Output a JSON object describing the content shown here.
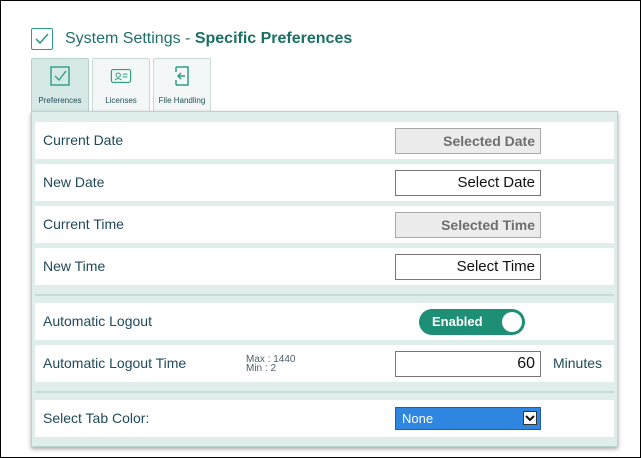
{
  "header": {
    "title_prefix": "System Settings - ",
    "title_emphasis": "Specific Preferences"
  },
  "tabs": [
    {
      "label": "Preferences",
      "icon": "checkbox-icon",
      "active": true
    },
    {
      "label": "Licenses",
      "icon": "license-card-icon",
      "active": false
    },
    {
      "label": "File Handling",
      "icon": "file-import-icon",
      "active": false
    }
  ],
  "settings": {
    "current_date": {
      "label": "Current Date",
      "value": "Selected Date"
    },
    "new_date": {
      "label": "New Date",
      "value": "Select Date"
    },
    "current_time": {
      "label": "Current Time",
      "value": "Selected Time"
    },
    "new_time": {
      "label": "New Time",
      "value": "Select Time"
    },
    "auto_logout": {
      "label": "Automatic Logout",
      "toggle_label": "Enabled",
      "enabled": true
    },
    "auto_logout_time": {
      "label": "Automatic Logout Time",
      "max_text": "Max  : 1440",
      "min_text": "Min   : 2",
      "value": "60",
      "unit": "Minutes"
    },
    "tab_color": {
      "label": "Select Tab Color:",
      "selected": "None"
    }
  },
  "colors": {
    "accent": "#1d8f74",
    "title_text": "#1f6f6a",
    "select_bg": "#2f86e0"
  }
}
